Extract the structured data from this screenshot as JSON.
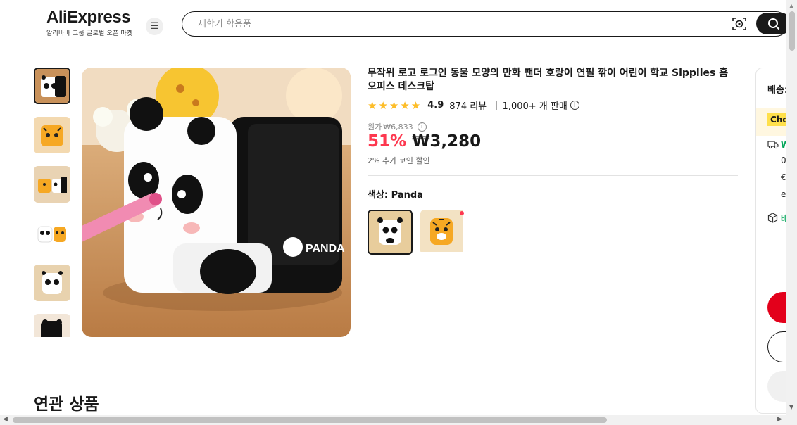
{
  "header": {
    "logo_text": "AliExpress",
    "logo_subtitle": "알리바바 그룹 글로벌 오픈 마켓",
    "menu_icon": "hamburger-icon",
    "search_placeholder": "새학기 학용품",
    "camera_icon": "camera-search-icon",
    "search_icon": "search-icon"
  },
  "product": {
    "title": "무작위 로고 로그인 동물 모양의 만화 팬더 호랑이 연필 깎이 어린이 학교 Sipplies 홈 오피스 데스크탑",
    "rating_stars": "★★★★★",
    "rating": "4.9",
    "reviews": "874 리뷰",
    "sold": "1,000+ 개 판매",
    "original_label": "원가",
    "original_price": "₩6,833",
    "discount": "51%",
    "price": "₩3,280",
    "coin_text": "2% 추가 코인 할인",
    "color_label": "색상: Panda",
    "swatches": [
      "Panda",
      "Tiger"
    ]
  },
  "panel": {
    "title": "배송:",
    "choice_badge": "Choice",
    "green_text": "W",
    "line1": "0",
    "line2": "€",
    "line3": "e",
    "box_text": "배"
  },
  "related": {
    "title": "연관 상품"
  },
  "colors": {
    "accent": "#fd384f",
    "brand_red": "#e3001b",
    "star": "#fdbd28",
    "choice": "#ffe04b"
  }
}
